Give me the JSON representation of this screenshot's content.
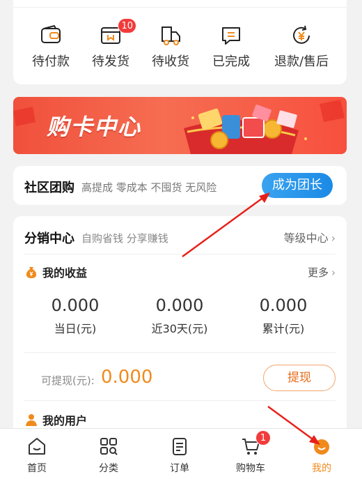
{
  "orders": {
    "items": [
      {
        "label": "待付款",
        "icon": "wallet-icon"
      },
      {
        "label": "待发货",
        "icon": "package-icon",
        "badge": "10"
      },
      {
        "label": "待收货",
        "icon": "truck-icon"
      },
      {
        "label": "已完成",
        "icon": "message-list-icon"
      },
      {
        "label": "退款/售后",
        "icon": "refund-yen-icon"
      }
    ]
  },
  "banner": {
    "title": "购卡中心"
  },
  "community": {
    "title": "社区团购",
    "subtitle": "高提成 零成本 不囤货 无风险",
    "button": "成为团长"
  },
  "distribution": {
    "title": "分销中心",
    "subtitle": "自购省钱 分享赚钱",
    "level_link": "等级中心",
    "earnings": {
      "title": "我的收益",
      "more": "更多",
      "stats": [
        {
          "value": "0.000",
          "caption": "当日(元)"
        },
        {
          "value": "0.000",
          "caption": "近30天(元)"
        },
        {
          "value": "0.000",
          "caption": "累计(元)"
        }
      ]
    },
    "withdraw": {
      "label": "可提现(元):",
      "amount": "0.000",
      "button": "提现"
    },
    "users": {
      "title": "我的用户"
    }
  },
  "nav": {
    "items": [
      {
        "label": "首页",
        "icon": "home-icon"
      },
      {
        "label": "分类",
        "icon": "category-grid-icon"
      },
      {
        "label": "订单",
        "icon": "order-list-icon"
      },
      {
        "label": "购物车",
        "icon": "cart-icon",
        "badge": "1"
      },
      {
        "label": "我的",
        "icon": "profile-icon",
        "active": true
      }
    ]
  },
  "colors": {
    "accent_orange": "#f08a1c",
    "badge_red": "#f23b3b",
    "button_blue": "#1b8ae6",
    "banner_red": "#f0503c"
  }
}
